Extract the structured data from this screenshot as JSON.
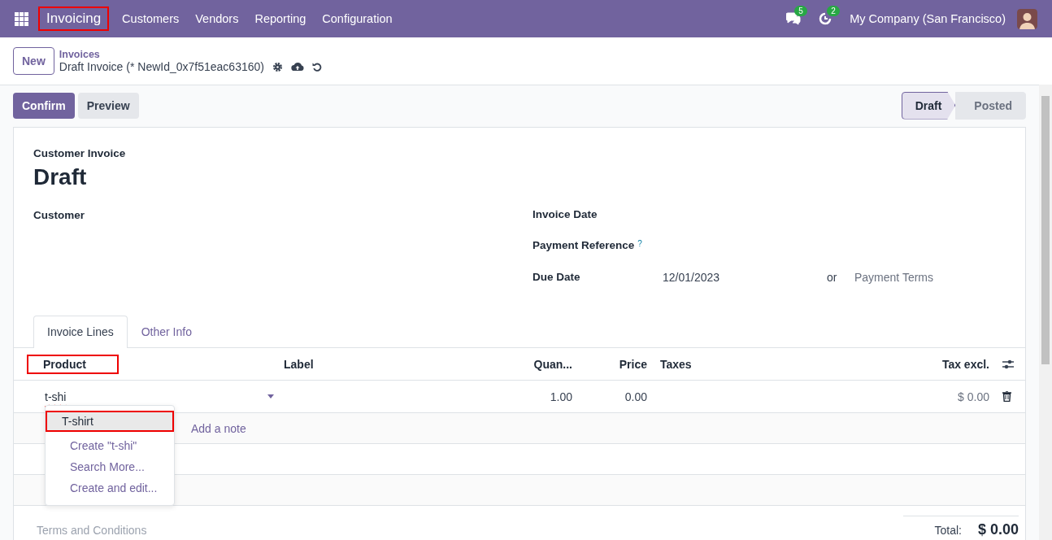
{
  "navbar": {
    "app_title": "Invoicing",
    "highlighted": true,
    "menus": [
      "Customers",
      "Vendors",
      "Reporting",
      "Configuration"
    ],
    "messages_count": "5",
    "activities_count": "2",
    "company": "My Company (San Francisco)"
  },
  "breadcrumb": {
    "new_button": "New",
    "parent": "Invoices",
    "current": "Draft Invoice (* NewId_0x7f51eac63160)"
  },
  "actions": [
    {
      "label": "Confirm",
      "kind": "primary"
    },
    {
      "label": "Preview",
      "kind": "secondary"
    }
  ],
  "status_steps": [
    {
      "label": "Draft",
      "selected": true
    },
    {
      "label": "Posted",
      "selected": false
    }
  ],
  "form": {
    "type_label": "Customer Invoice",
    "title": "Draft",
    "customer_label": "Customer",
    "right_fields": [
      {
        "label": "Invoice Date"
      },
      {
        "label": "Payment Reference",
        "help": "?"
      },
      {
        "label": "Due Date",
        "value": "12/01/2023",
        "separator": "or",
        "placeholder": "Payment Terms"
      }
    ]
  },
  "tabs": [
    {
      "label": "Invoice Lines",
      "selected": true
    },
    {
      "label": "Other Info",
      "selected": false
    }
  ],
  "table": {
    "columns": [
      {
        "label": "Product",
        "highlighted": true
      },
      {
        "label": "Label",
        "highlighted": false
      },
      {
        "label": "Quan...",
        "highlighted": false
      },
      {
        "label": "Price",
        "highlighted": false
      },
      {
        "label": "Taxes",
        "highlighted": false
      },
      {
        "label": "Tax excl.",
        "highlighted": false
      }
    ],
    "rows": [
      {
        "product": "t-shi",
        "quantity": "1.00",
        "price": "0.00",
        "subtotal": "$ 0.00"
      }
    ],
    "add_note": "Add a note"
  },
  "autocomplete": [
    {
      "label": "T-shirt",
      "kind": "record",
      "selected": true,
      "highlighted": true
    },
    {
      "label": "Create \"t-shi\"",
      "kind": "action",
      "selected": false,
      "highlighted": false
    },
    {
      "label": "Search More...",
      "kind": "action",
      "selected": false,
      "highlighted": false
    },
    {
      "label": "Create and edit...",
      "kind": "action",
      "selected": false,
      "highlighted": false
    }
  ],
  "terms_placeholder": "Terms and Conditions",
  "total": {
    "label": "Total:",
    "value": "$ 0.00"
  }
}
